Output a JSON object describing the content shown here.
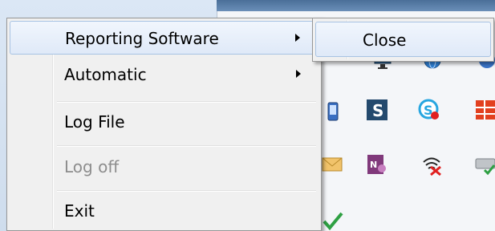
{
  "context_menu": {
    "items": [
      {
        "label": "Reporting Software",
        "has_submenu": true,
        "state": "highlighted"
      },
      {
        "label": "Automatic",
        "has_submenu": true,
        "state": "normal"
      },
      {
        "label": "Log File",
        "has_submenu": false,
        "state": "normal"
      },
      {
        "label": "Log off",
        "has_submenu": false,
        "state": "disabled"
      },
      {
        "label": "Exit",
        "has_submenu": false,
        "state": "normal"
      }
    ]
  },
  "submenu": {
    "items": [
      {
        "label": "Close",
        "state": "highlighted"
      }
    ]
  },
  "tray_icons": [
    "monitor-icon",
    "blue-globe-icon",
    "blue-app-icon",
    "phone-icon",
    "stream-s-icon",
    "skype-icon",
    "orange-grid-icon",
    "envelope-icon",
    "onenote-icon",
    "wifi-disconnected-icon",
    "drive-check-icon",
    "green-check-icon"
  ],
  "colors": {
    "menu_bg": "#f0f0f0",
    "highlight_border": "#a8c3e3",
    "disabled_text": "#8d8d8d"
  }
}
